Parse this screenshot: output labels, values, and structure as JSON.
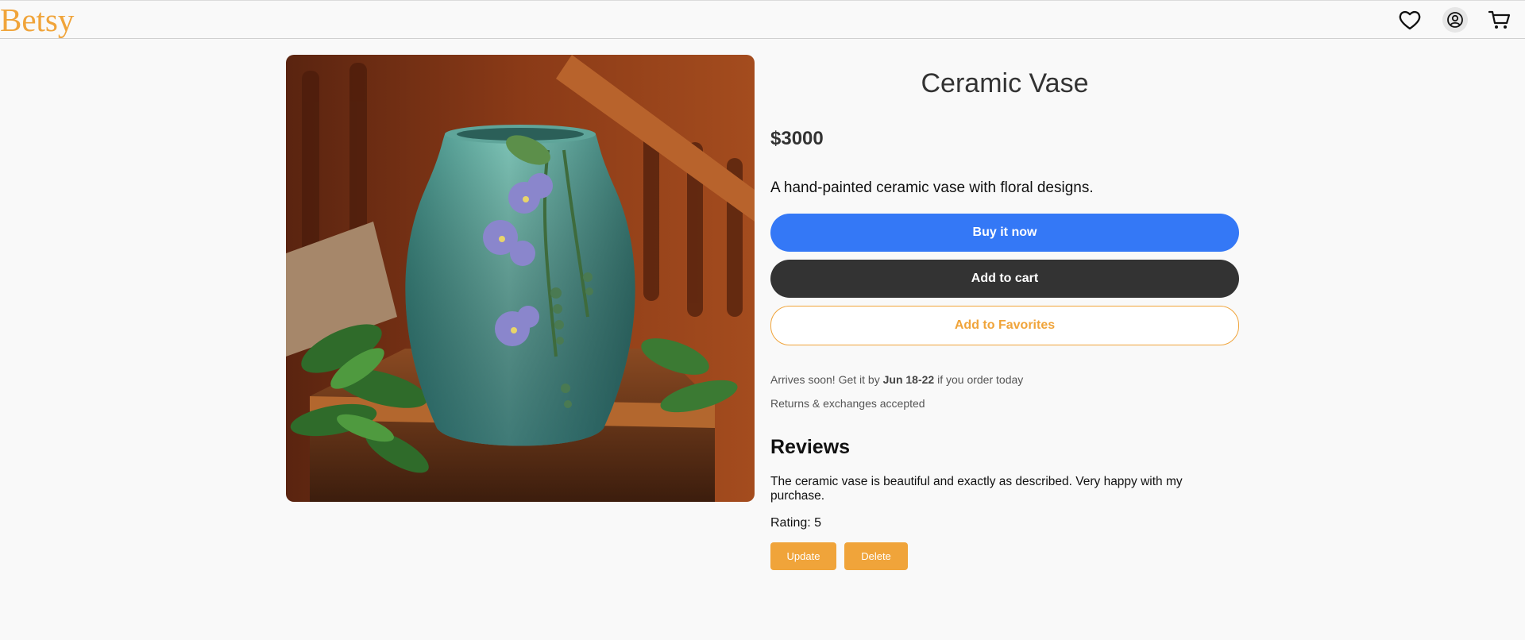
{
  "header": {
    "logo": "Betsy",
    "icons": [
      "heart-icon",
      "profile-icon",
      "cart-icon"
    ]
  },
  "product": {
    "image_alt": "Ceramic vase with floral designs",
    "title": "Ceramic Vase",
    "price": "$3000",
    "description": "A hand-painted ceramic vase with floral designs.",
    "buy_label": "Buy it now",
    "cart_label": "Add to cart",
    "favorites_label": "Add to Favorites",
    "shipping_prefix": "Arrives soon! Get it by ",
    "shipping_date": "Jun 18-22",
    "shipping_suffix": " if you order today",
    "returns": "Returns & exchanges accepted"
  },
  "reviews": {
    "heading": "Reviews",
    "items": [
      {
        "text": "The ceramic vase is beautiful and exactly as described. Very happy with my purchase.",
        "rating_label": "Rating: 5",
        "update_label": "Update",
        "delete_label": "Delete"
      }
    ]
  },
  "colors": {
    "brand": "#f0a43a",
    "buy": "#3478f6",
    "cart": "#333333",
    "background": "#f9f9f9"
  }
}
